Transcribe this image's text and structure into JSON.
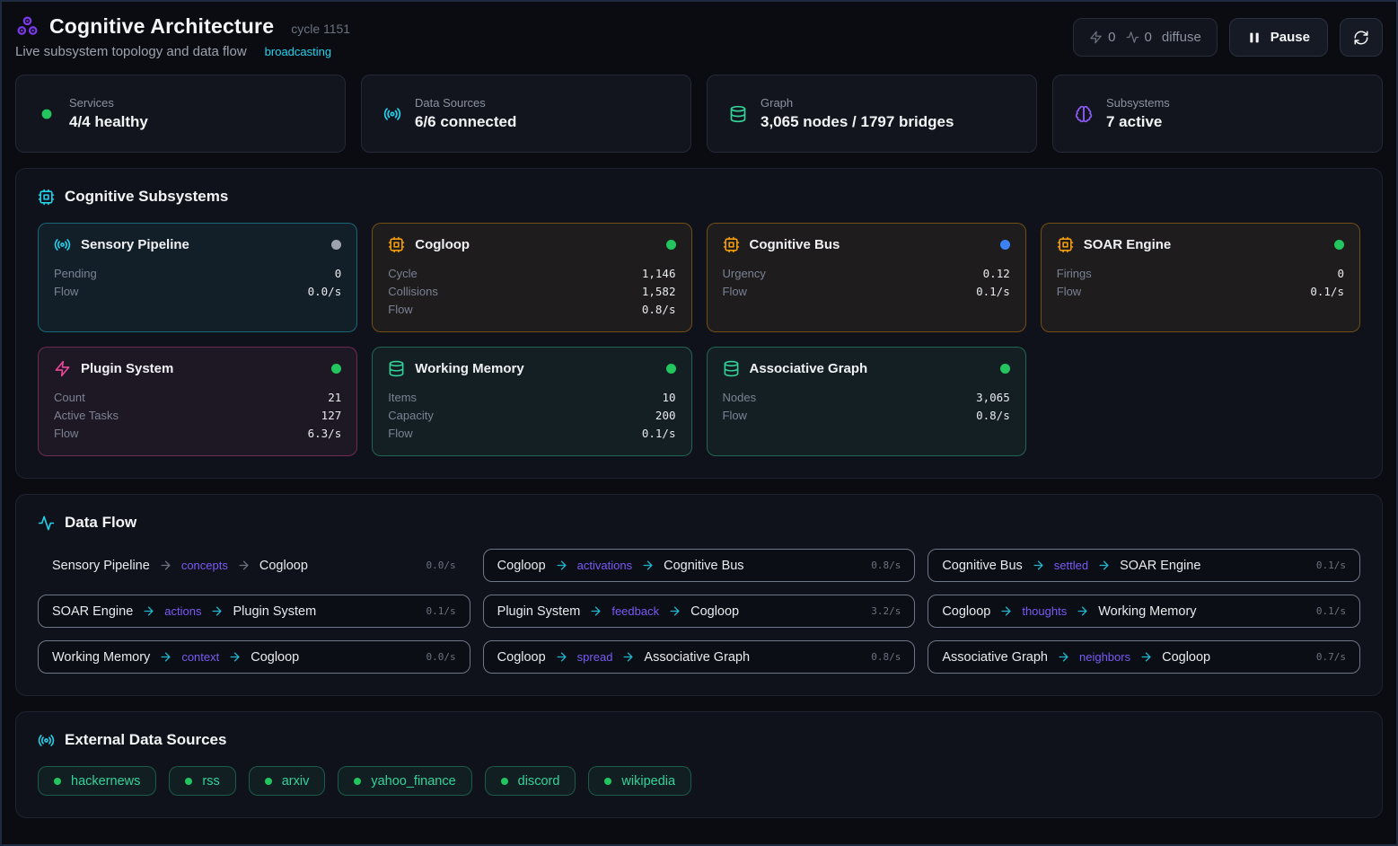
{
  "header": {
    "title": "Cognitive Architecture",
    "cycle": "cycle 1151",
    "subtitle": "Live subsystem topology and data flow",
    "status": "broadcasting",
    "badge": {
      "zap_count": "0",
      "pulse_count": "0",
      "mode": "diffuse"
    },
    "pause_label": "Pause"
  },
  "theme": {
    "cyan": "#22d3ee",
    "purple": "#7c3aed",
    "flow_label_purple": "#7a5af5",
    "green": "#22c55e",
    "emerald": "#34d399",
    "amber": "#f59e0b",
    "pink": "#ec4899",
    "blue": "#3b82f6",
    "gray": "#9ca3af"
  },
  "stats": [
    {
      "label": "Services",
      "value": "4/4 healthy",
      "icon": "dot",
      "color": "#22c55e"
    },
    {
      "label": "Data Sources",
      "value": "6/6 connected",
      "icon": "radio",
      "color": "#22d3ee"
    },
    {
      "label": "Graph",
      "value": "3,065 nodes / 1797 bridges",
      "icon": "database",
      "color": "#34d399"
    },
    {
      "label": "Subsystems",
      "value": "7 active",
      "icon": "brain",
      "color": "#8b5cf6"
    }
  ],
  "subsystems": {
    "title": "Cognitive Subsystems",
    "cards": [
      {
        "name": "Sensory Pipeline",
        "icon": "radio",
        "accent": "#22d3ee",
        "status_color": "#9ca3af",
        "stats": [
          {
            "label": "Pending",
            "value": "0"
          },
          {
            "label": "Flow",
            "value": "0.0/s"
          }
        ]
      },
      {
        "name": "Cogloop",
        "icon": "cpu",
        "accent": "#f59e0b",
        "status_color": "#22c55e",
        "stats": [
          {
            "label": "Cycle",
            "value": "1,146"
          },
          {
            "label": "Collisions",
            "value": "1,582"
          },
          {
            "label": "Flow",
            "value": "0.8/s"
          }
        ]
      },
      {
        "name": "Cognitive Bus",
        "icon": "cpu",
        "accent": "#f59e0b",
        "status_color": "#3b82f6",
        "stats": [
          {
            "label": "Urgency",
            "value": "0.12"
          },
          {
            "label": "Flow",
            "value": "0.1/s"
          }
        ]
      },
      {
        "name": "SOAR Engine",
        "icon": "cpu",
        "accent": "#f59e0b",
        "status_color": "#22c55e",
        "stats": [
          {
            "label": "Firings",
            "value": "0"
          },
          {
            "label": "Flow",
            "value": "0.1/s"
          }
        ]
      },
      {
        "name": "Plugin System",
        "icon": "zap",
        "accent": "#ec4899",
        "status_color": "#22c55e",
        "stats": [
          {
            "label": "Count",
            "value": "21"
          },
          {
            "label": "Active Tasks",
            "value": "127"
          },
          {
            "label": "Flow",
            "value": "6.3/s"
          }
        ]
      },
      {
        "name": "Working Memory",
        "icon": "database",
        "accent": "#34d399",
        "status_color": "#22c55e",
        "stats": [
          {
            "label": "Items",
            "value": "10"
          },
          {
            "label": "Capacity",
            "value": "200"
          },
          {
            "label": "Flow",
            "value": "0.1/s"
          }
        ]
      },
      {
        "name": "Associative Graph",
        "icon": "database",
        "accent": "#34d399",
        "status_color": "#22c55e",
        "stats": [
          {
            "label": "Nodes",
            "value": "3,065"
          },
          {
            "label": "Flow",
            "value": "0.8/s"
          }
        ]
      }
    ]
  },
  "dataflow": {
    "title": "Data Flow",
    "flows": [
      {
        "source": "Sensory Pipeline",
        "label": "concepts",
        "target": "Cogloop",
        "rate": "0.0/s",
        "active": false
      },
      {
        "source": "Cogloop",
        "label": "activations",
        "target": "Cognitive Bus",
        "rate": "0.8/s",
        "active": true
      },
      {
        "source": "Cognitive Bus",
        "label": "settled",
        "target": "SOAR Engine",
        "rate": "0.1/s",
        "active": true
      },
      {
        "source": "SOAR Engine",
        "label": "actions",
        "target": "Plugin System",
        "rate": "0.1/s",
        "active": true
      },
      {
        "source": "Plugin System",
        "label": "feedback",
        "target": "Cogloop",
        "rate": "3.2/s",
        "active": true
      },
      {
        "source": "Cogloop",
        "label": "thoughts",
        "target": "Working Memory",
        "rate": "0.1/s",
        "active": true
      },
      {
        "source": "Working Memory",
        "label": "context",
        "target": "Cogloop",
        "rate": "0.0/s",
        "active": true
      },
      {
        "source": "Cogloop",
        "label": "spread",
        "target": "Associative Graph",
        "rate": "0.8/s",
        "active": true
      },
      {
        "source": "Associative Graph",
        "label": "neighbors",
        "target": "Cogloop",
        "rate": "0.7/s",
        "active": true
      }
    ]
  },
  "sources": {
    "title": "External Data Sources",
    "items": [
      "hackernews",
      "rss",
      "arxiv",
      "yahoo_finance",
      "discord",
      "wikipedia"
    ]
  }
}
